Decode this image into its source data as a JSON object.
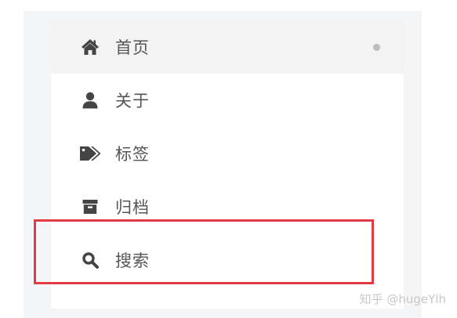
{
  "menu": {
    "items": [
      {
        "icon": "home-icon",
        "label": "首页",
        "active": true
      },
      {
        "icon": "user-icon",
        "label": "关于",
        "active": false
      },
      {
        "icon": "tags-icon",
        "label": "标签",
        "active": false
      },
      {
        "icon": "archive-icon",
        "label": "归档",
        "active": false
      },
      {
        "icon": "search-icon",
        "label": "搜索",
        "active": false
      }
    ]
  },
  "colors": {
    "label_text": "#555555",
    "icon": "#444444",
    "active_background": "#f3f3f3",
    "highlight_border": "#e33b42"
  },
  "watermark": "知乎 @hugeYlh"
}
